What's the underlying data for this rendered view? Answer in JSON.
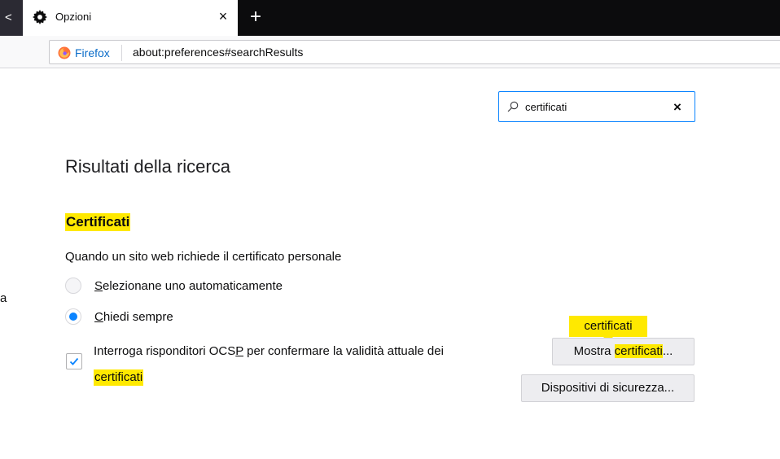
{
  "tab": {
    "title": "Opzioni",
    "close": "×",
    "back_glyph": "<"
  },
  "newtab": {
    "glyph": "+"
  },
  "urlbar": {
    "identity": "Firefox",
    "url": "about:preferences#searchResults"
  },
  "search": {
    "value": "certificati",
    "clear": "×"
  },
  "page": {
    "title": "Risultati della ricerca"
  },
  "section": {
    "heading": "Certificati",
    "description": "Quando un sito web richiede il certificato personale",
    "radio_auto": {
      "accel": "S",
      "rest": "elezionane uno automaticamente",
      "checked": false
    },
    "radio_ask": {
      "accel": "C",
      "rest": "hiedi sempre",
      "checked": true
    },
    "ocsp": {
      "pre": "Interroga risponditori OCS",
      "accel": "P",
      "post": " per confermare la validità attuale dei",
      "line2": "certificati",
      "checked": true
    },
    "tooltip": "certificati",
    "btn_certs": {
      "pre": "Mostra ",
      "highlight": "certificati",
      "post": "..."
    },
    "btn_devices": "Dispositivi di sicurezza..."
  },
  "edge_glyph": "a",
  "colors": {
    "highlight": "#ffe900",
    "accent": "#0a84ff",
    "tabstrip": "#0c0c0d"
  },
  "icons": {
    "tab": "gear-icon",
    "search": "search-icon",
    "identity": "firefox-logo-icon",
    "check": "checkmark-icon"
  }
}
